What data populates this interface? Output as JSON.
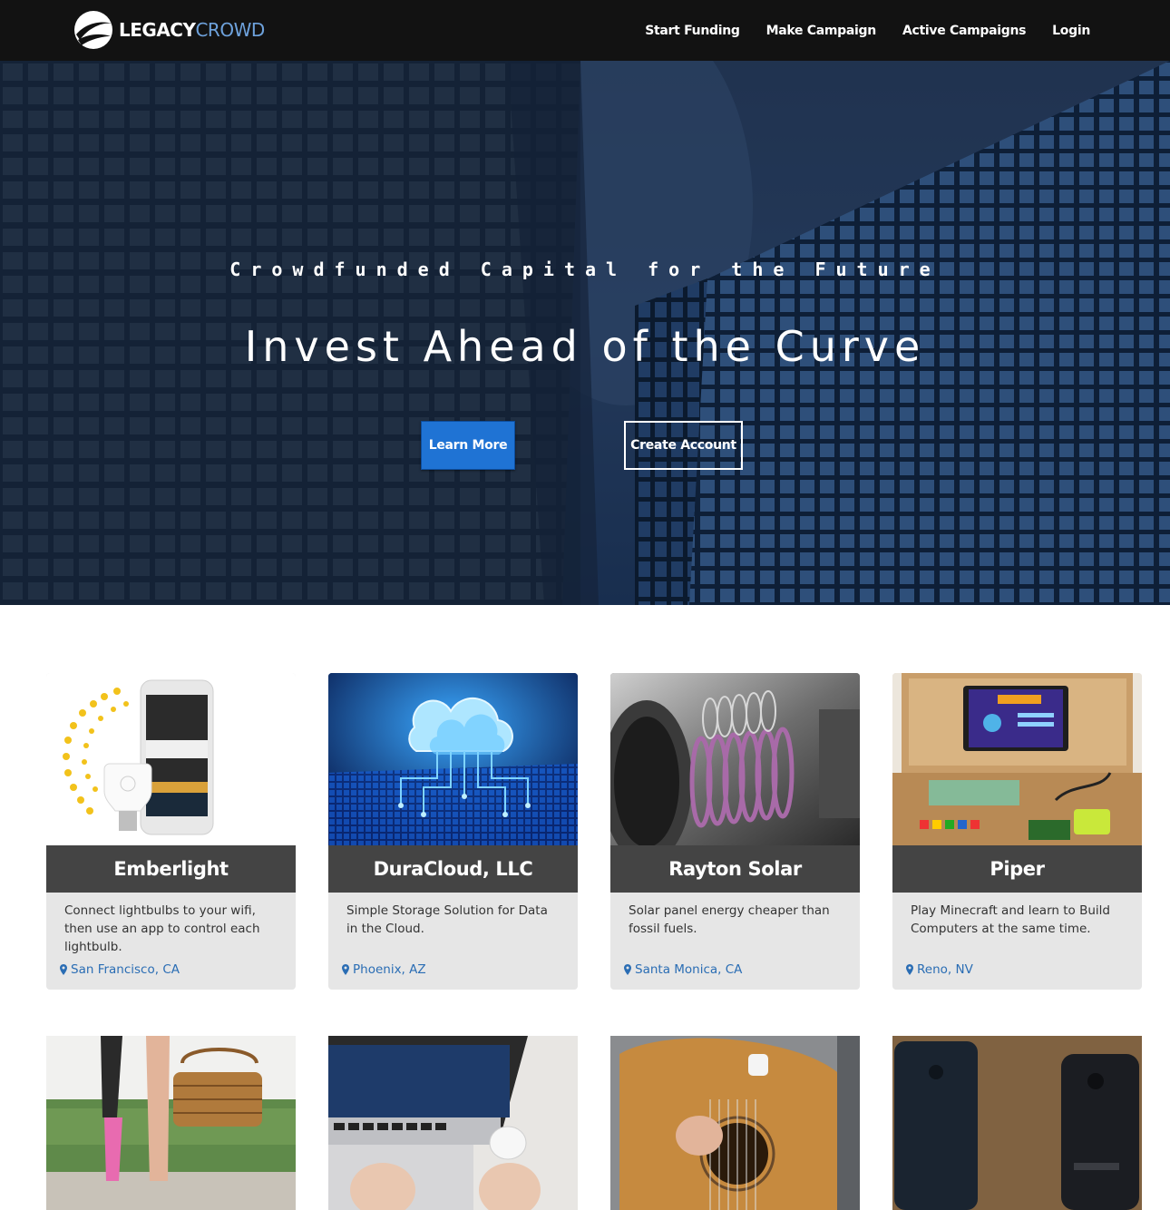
{
  "brand": {
    "name_part1": "LEGACY",
    "name_part2": "CROWD"
  },
  "nav": {
    "items": [
      {
        "label": "Start Funding"
      },
      {
        "label": "Make Campaign"
      },
      {
        "label": "Active Campaigns"
      },
      {
        "label": "Login"
      }
    ]
  },
  "hero": {
    "tagline": "Crowdfunded Capital for the Future",
    "title": "Invest Ahead of the Curve",
    "primary_button": "Learn More",
    "secondary_button": "Create Account"
  },
  "campaigns": [
    {
      "title": "Emberlight",
      "description": "Connect lightbulbs to your wifi, then use an app to control each lightbulb.",
      "location": "San Francisco, CA"
    },
    {
      "title": "DuraCloud, LLC",
      "description": "Simple Storage Solution for Data in the Cloud.",
      "location": "Phoenix, AZ"
    },
    {
      "title": "Rayton Solar",
      "description": "Solar panel energy cheaper than fossil fuels.",
      "location": "Santa Monica, CA"
    },
    {
      "title": "Piper",
      "description": "Play Minecraft and learn to Build Computers at the same time.",
      "location": "Reno, NV"
    }
  ],
  "colors": {
    "nav_bg": "#121212",
    "accent": "#1f73d4",
    "link": "#2a6db4",
    "card_title_bg": "#444444",
    "card_bg": "#e6e6e6"
  },
  "icons": {
    "location": "map-marker-icon",
    "logo": "globe-swoosh-icon"
  }
}
